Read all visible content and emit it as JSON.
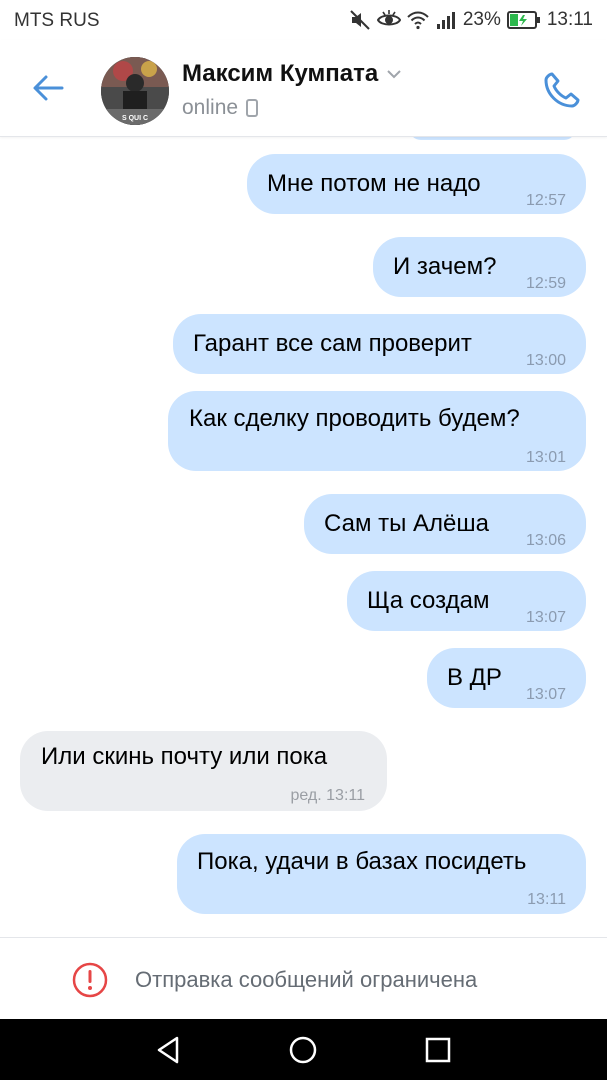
{
  "status": {
    "carrier": "MTS RUS",
    "battery": "23%",
    "time": "13:11"
  },
  "header": {
    "name": "Максим Кумпата",
    "presence": "online",
    "avatar_text": "S QUI C"
  },
  "messages": [
    {
      "dir": "out",
      "text": "Мне потом не надо",
      "time": "12:57"
    },
    {
      "dir": "out",
      "text": "И зачем?",
      "time": "12:59"
    },
    {
      "dir": "out",
      "text": "Гарант все сам проверит",
      "time": "13:00"
    },
    {
      "dir": "out",
      "text": "Как сделку проводить будем?",
      "time": "13:01"
    },
    {
      "dir": "out",
      "text": "Сам ты Алёша",
      "time": "13:06"
    },
    {
      "dir": "out",
      "text": "Ща создам",
      "time": "13:07"
    },
    {
      "dir": "out",
      "text": "В ДР",
      "time": "13:07"
    },
    {
      "dir": "in",
      "text": "Или скинь почту или пока",
      "time": "ред. 13:11"
    },
    {
      "dir": "out",
      "text": "Пока, удачи в базах посидеть",
      "time": "13:11"
    }
  ],
  "footer": {
    "notice": "Отправка сообщений ограничена"
  },
  "colors": {
    "accent": "#4a90d9",
    "bubble_out": "#cce4ff",
    "bubble_in": "#ebedf0",
    "warning": "#e64646"
  }
}
